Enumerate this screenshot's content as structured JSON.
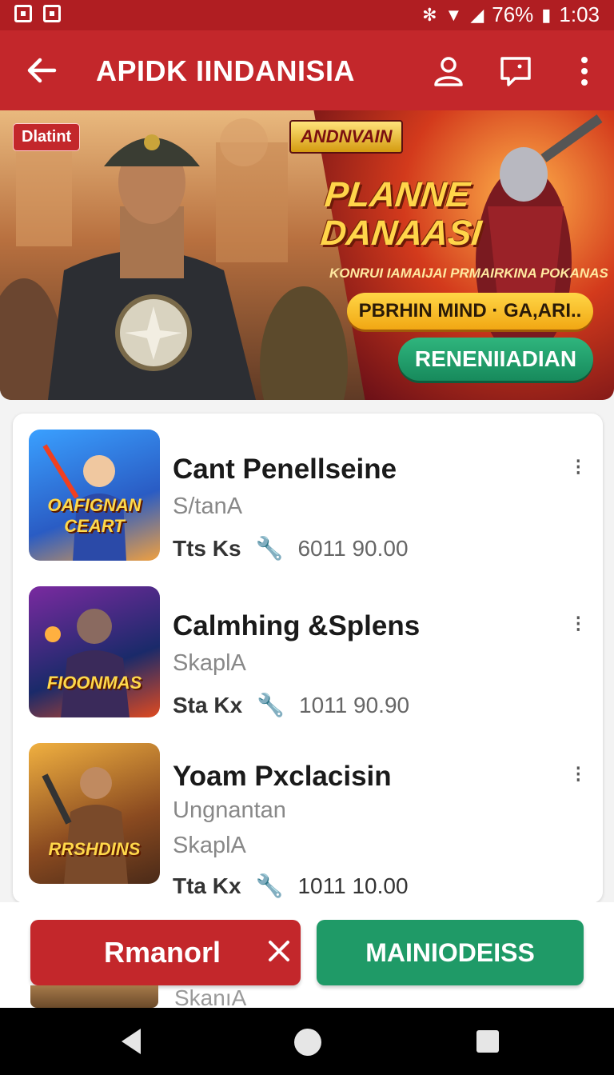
{
  "status_bar": {
    "battery": "76%",
    "time": "1:03"
  },
  "app_bar": {
    "title": "APIDK IINDANISIA"
  },
  "banner": {
    "tag": "Dlatint",
    "logo_text": "ANDNVAIN",
    "headline_line1": "PLANNE",
    "headline_line2": "DANAASI",
    "subtitle": "KONRUI IAMAIJAI PRMAIRKINA POKANAS",
    "pill_label": "PBRHIN MIND · GA,ARI..",
    "cta_label": "RENENIIADIAN"
  },
  "games": [
    {
      "title": "Cant Penellseine",
      "subtitle": "S/tanA",
      "meta_key": "Tts Ks",
      "meta_value": "6011  90.00",
      "thumb_label": "OAFIGNAN CEART",
      "thumb_colors": [
        "#3aa0ff",
        "#2a5cc4",
        "#f0a040"
      ]
    },
    {
      "title": "Calmhing &Splens",
      "subtitle": "SkaplA",
      "meta_key": "Sta Kx",
      "meta_value": "1011  90.90",
      "thumb_label": "FIOONMAS",
      "thumb_colors": [
        "#7a2aa0",
        "#1a2a6a",
        "#e04a20"
      ]
    },
    {
      "title": "Yoam Pxclacisin",
      "subtitle": "Ungnantan",
      "subtitle2": "SkaplA",
      "meta_key": "Tta Kx",
      "meta_value": "1011  10.00",
      "thumb_label": "RRSHDINS",
      "thumb_colors": [
        "#f0b040",
        "#8a4a20",
        "#4a2a18"
      ]
    }
  ],
  "actions": {
    "primary_label": "Rmanorl",
    "secondary_label": "MAINIODEISS",
    "peek_text": "SkanıA"
  },
  "colors": {
    "brand_red": "#c3272b",
    "accent_green": "#1f9a67"
  }
}
